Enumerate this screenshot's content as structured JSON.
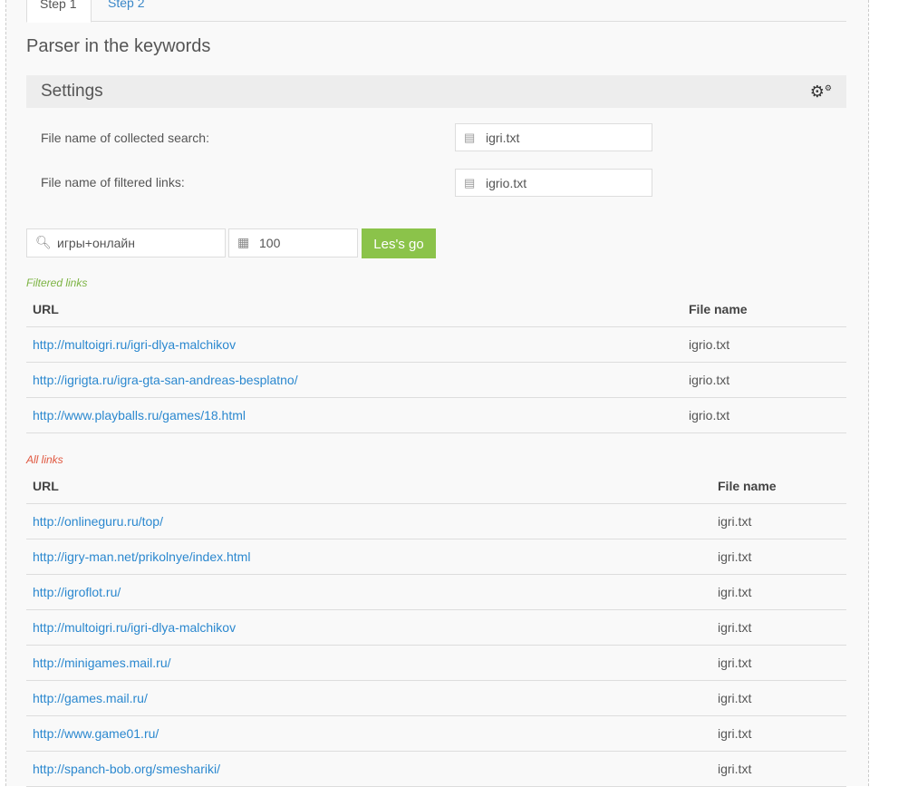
{
  "tabs": [
    "Step 1",
    "Step 2"
  ],
  "title": "Parser in the keywords",
  "settings": {
    "label": "Settings",
    "icon": "gears-icon"
  },
  "fields": [
    {
      "label": "File name of collected search:",
      "value": "igri.txt"
    },
    {
      "label": "File name of filtered links:",
      "value": "igrio.txt"
    }
  ],
  "search": {
    "query": "игры+онлайн",
    "count": "100",
    "button": "Les's go"
  },
  "filtered": {
    "caption": "Filtered links",
    "headers": [
      "URL",
      "File name"
    ],
    "rows": [
      [
        "http://multoigri.ru/igri-dlya-malchikov",
        "igrio.txt"
      ],
      [
        "http://igrigta.ru/igra-gta-san-andreas-besplatno/",
        "igrio.txt"
      ],
      [
        "http://www.playballs.ru/games/18.html",
        "igrio.txt"
      ]
    ]
  },
  "all": {
    "caption": "All links",
    "headers": [
      "URL",
      "File name"
    ],
    "rows": [
      [
        "http://onlineguru.ru/top/",
        "igri.txt"
      ],
      [
        "http://igry-man.net/prikolnye/index.html",
        "igri.txt"
      ],
      [
        "http://igroflot.ru/",
        "igri.txt"
      ],
      [
        "http://multoigri.ru/igri-dlya-malchikov",
        "igri.txt"
      ],
      [
        "http://minigames.mail.ru/",
        "igri.txt"
      ],
      [
        "http://games.mail.ru/",
        "igri.txt"
      ],
      [
        "http://www.game01.ru/",
        "igri.txt"
      ],
      [
        "http://spanch-bob.org/smeshariki/",
        "igri.txt"
      ]
    ]
  },
  "colors": {
    "accent": "#8bc34a",
    "link": "#2b88cf",
    "filtered_caption": "#7cb342",
    "all_caption": "#e0573f"
  }
}
